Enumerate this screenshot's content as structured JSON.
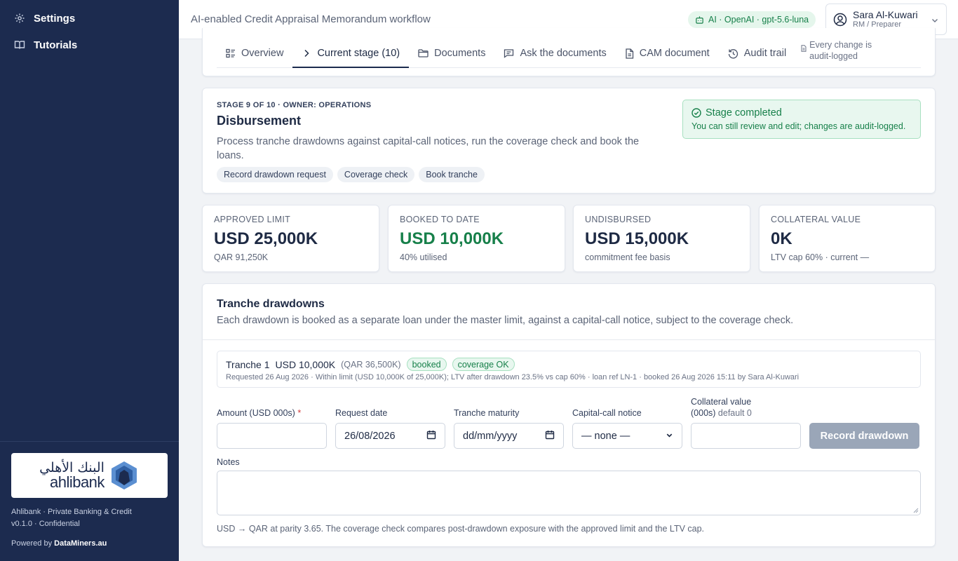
{
  "sidebar": {
    "items": [
      {
        "label": "Settings",
        "icon": "gear-icon"
      },
      {
        "label": "Tutorials",
        "icon": "book-icon"
      }
    ],
    "logo": {
      "arabic": "البنك الأهلي",
      "english": "ahlibank"
    },
    "footer": {
      "line1": "Ahlibank · Private Banking & Credit",
      "line2": "v0.1.0 · Confidential",
      "powered_prefix": "Powered by",
      "powered_by": "DataMiners.au"
    }
  },
  "topbar": {
    "title": "AI-enabled Credit Appraisal Memorandum workflow",
    "ai_pill": "AI · OpenAI · gpt-5.6-luna",
    "user": {
      "name": "Sara Al-Kuwari",
      "role": "RM / Preparer"
    }
  },
  "tabs": [
    {
      "label": "Overview",
      "icon": "list-icon"
    },
    {
      "label": "Current stage (10)",
      "icon": "chevron-right-icon",
      "active": true
    },
    {
      "label": "Documents",
      "icon": "folder-icon"
    },
    {
      "label": "Ask the documents",
      "icon": "message-icon"
    },
    {
      "label": "CAM document",
      "icon": "file-icon"
    },
    {
      "label": "Audit trail",
      "icon": "history-icon"
    }
  ],
  "tab_note": {
    "line1": "Every change is",
    "line2": "audit-logged"
  },
  "stage": {
    "eyebrow": "STAGE 9 OF 10 · OWNER: OPERATIONS",
    "title": "Disbursement",
    "description": "Process tranche drawdowns against capital-call notices, run the coverage check and book the loans.",
    "chips": [
      "Record drawdown request",
      "Coverage check",
      "Book tranche"
    ],
    "status": {
      "title": "Stage completed",
      "subtitle": "You can still review and edit; changes are audit-logged."
    }
  },
  "kpis": [
    {
      "label": "APPROVED LIMIT",
      "value": "USD 25,000K",
      "sub": "QAR 91,250K",
      "color": "#1e2a44"
    },
    {
      "label": "BOOKED TO DATE",
      "value": "USD 10,000K",
      "sub": "40% utilised",
      "color": "#17804a"
    },
    {
      "label": "UNDISBURSED",
      "value": "USD 15,000K",
      "sub": "commitment fee basis",
      "color": "#1e2a44"
    },
    {
      "label": "COLLATERAL VALUE",
      "value": "0K",
      "sub": "LTV cap 60% · current —",
      "color": "#1e2a44"
    }
  ],
  "tranches": {
    "title": "Tranche drawdowns",
    "description": "Each drawdown is booked as a separate loan under the master limit, against a capital-call notice, subject to the coverage check.",
    "rows": [
      {
        "name": "Tranche 1",
        "amount": "USD 10,000K",
        "qar": "(QAR 36,500K)",
        "badges": [
          "booked",
          "coverage OK"
        ],
        "detail": "Requested 26 Aug 2026 · Within limit (USD 10,000K of 25,000K); LTV after drawdown 23.5% vs cap 60% · loan ref LN-1 · booked 26 Aug 2026 15:11 by Sara Al-Kuwari"
      }
    ],
    "form": {
      "amount_label": "Amount (USD 000s)",
      "amount_required": "*",
      "amount_value": "",
      "request_date_label": "Request date",
      "request_date_value": "26/08/2026",
      "maturity_label": "Tranche maturity",
      "maturity_placeholder": "dd/mm/yyyy",
      "capital_call_label": "Capital-call notice",
      "capital_call_value": "— none —",
      "collateral_label": "Collateral value",
      "collateral_label2": "(000s)",
      "collateral_hint": "default 0",
      "collateral_value": "",
      "record_button": "Record drawdown",
      "notes_label": "Notes",
      "notes_value": ""
    },
    "footnote": "USD → QAR at parity 3.65. The coverage check compares post-drawdown exposure with the approved limit and the LTV cap."
  },
  "colors": {
    "sidebar_bg": "#1c2b4f",
    "accent_green": "#17804a",
    "button_disabled": "#9aa6b8"
  }
}
